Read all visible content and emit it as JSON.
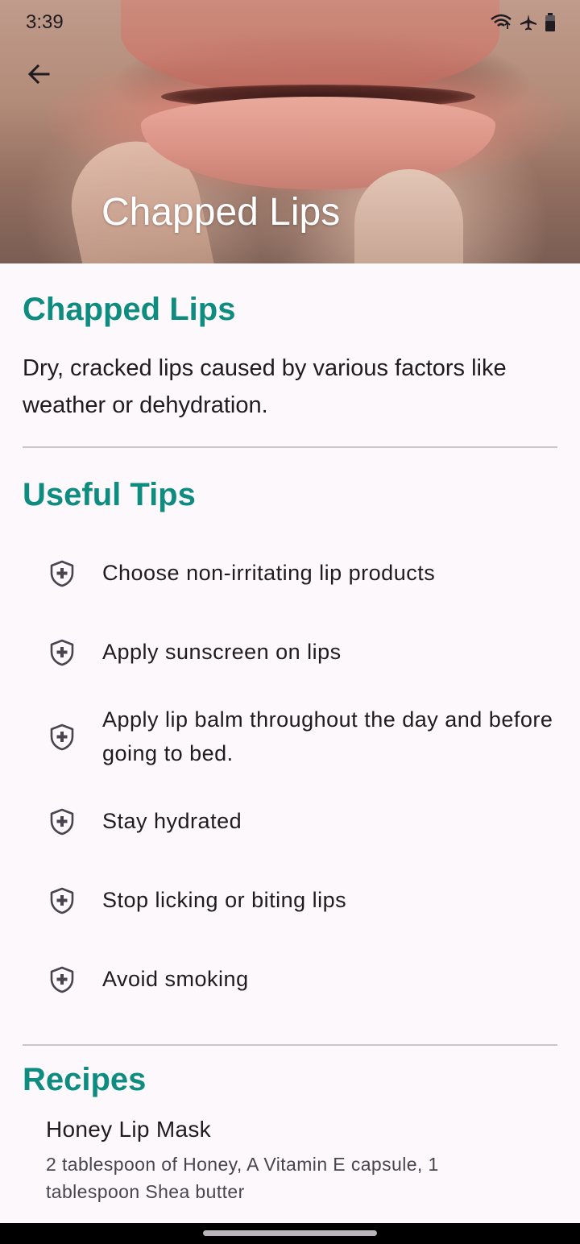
{
  "status_bar": {
    "time": "3:39",
    "icons": [
      "wifi-icon",
      "airplane-icon",
      "battery-icon"
    ]
  },
  "hero": {
    "title": "Chapped Lips",
    "image": "photo of chapped lips being pinched by fingers"
  },
  "condition": {
    "title": "Chapped Lips",
    "description": "Dry, cracked lips caused by various factors like weather or dehydration."
  },
  "tips": {
    "title": "Useful Tips",
    "items": [
      {
        "label": "Choose non-irritating lip products",
        "icon": "shield-plus-icon"
      },
      {
        "label": "Apply sunscreen on lips",
        "icon": "shield-plus-icon"
      },
      {
        "label": "Apply lip balm throughout the day and before going to bed.",
        "icon": "shield-plus-icon"
      },
      {
        "label": "Stay hydrated",
        "icon": "shield-plus-icon"
      },
      {
        "label": "Stop licking or biting lips",
        "icon": "shield-plus-icon"
      },
      {
        "label": "Avoid smoking",
        "icon": "shield-plus-icon"
      }
    ]
  },
  "recipes": {
    "title": "Recipes",
    "items": [
      {
        "name": "Honey Lip Mask",
        "ingredients": "2 tablespoon of Honey, A Vitamin E capsule, 1 tablespoon Shea butter"
      }
    ]
  },
  "colors": {
    "accent": "#0f8c80",
    "background": "#fdf8fc",
    "text": "#1f1b20",
    "secondary_text": "#49454f",
    "divider": "#cac4cc"
  }
}
